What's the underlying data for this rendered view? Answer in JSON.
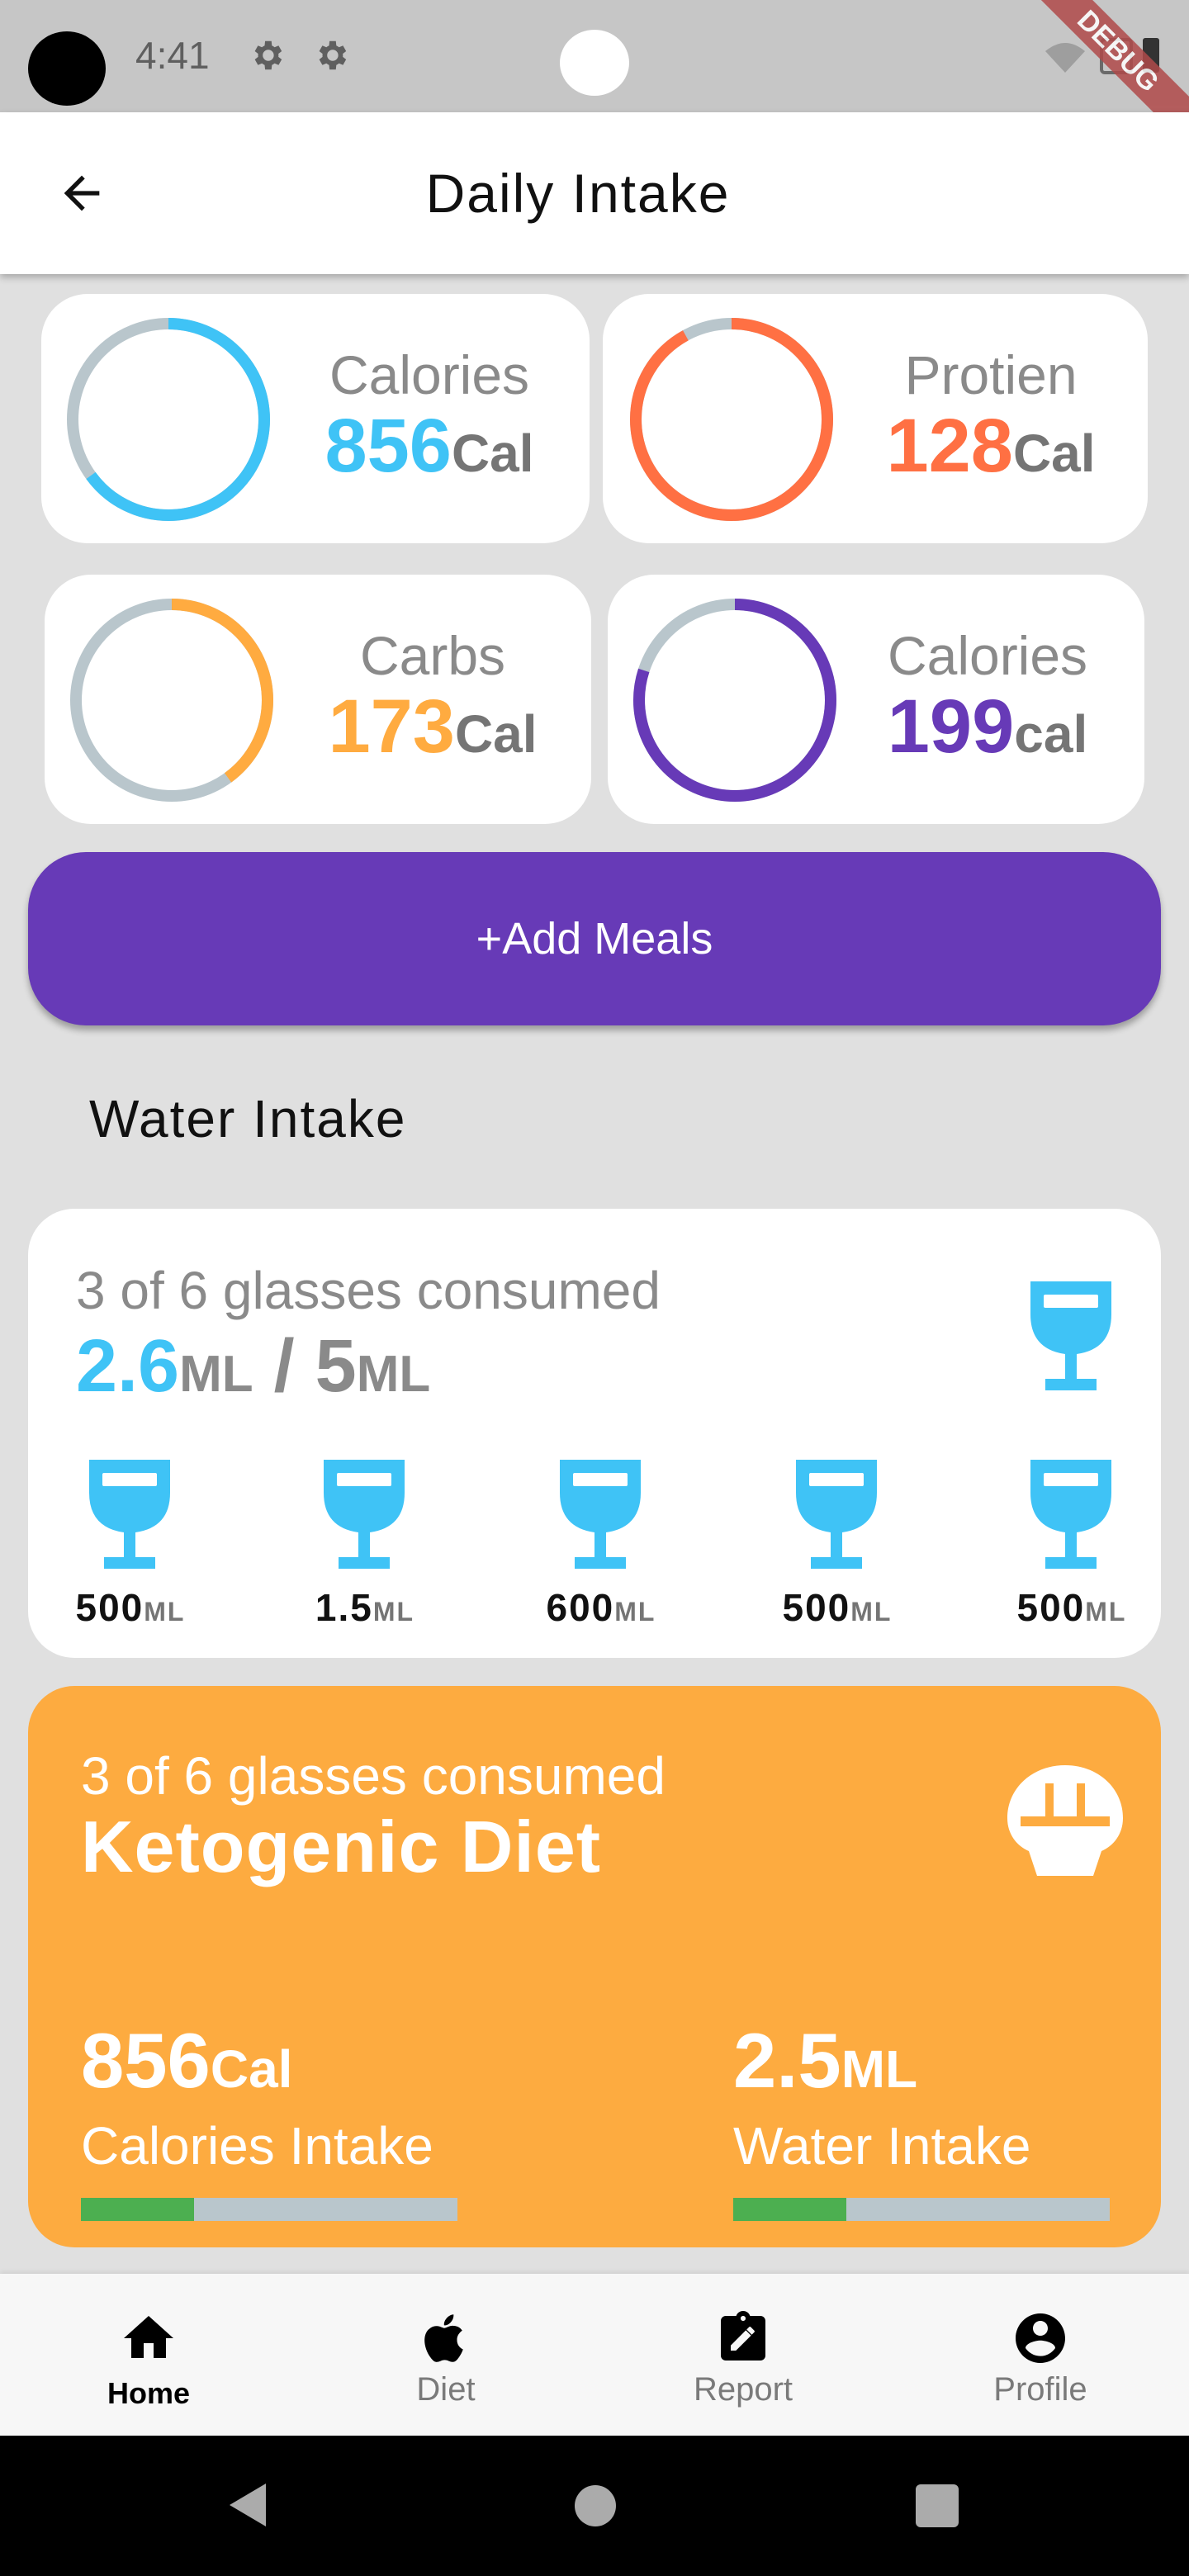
{
  "status_bar": {
    "time": "4:41",
    "debug_label": "DEBUG"
  },
  "app_bar": {
    "title": "Daily Intake"
  },
  "stats": [
    {
      "label": "Calories",
      "value": "856",
      "unit": "Cal",
      "color": "#3fc3f6",
      "progress": 0.65
    },
    {
      "label": "Protien",
      "value": "128",
      "unit": "Cal",
      "color": "#ff7043",
      "progress": 0.92
    },
    {
      "label": "Carbs",
      "value": "173",
      "unit": "Cal",
      "color": "#ffab40",
      "progress": 0.4
    },
    {
      "label": "Calories",
      "value": "199",
      "unit": "cal",
      "color": "#673ab7",
      "progress": 0.8
    }
  ],
  "add_meals_label": "+Add Meals",
  "water_section_title": "Water Intake",
  "water": {
    "consumed_text": "3 of 6 glasses consumed",
    "current": "2.6",
    "current_unit": "ML",
    "separator": " / ",
    "goal": "5",
    "goal_unit": "ML",
    "glasses": [
      {
        "amount": "500",
        "unit": "ML"
      },
      {
        "amount": "1.5",
        "unit": "ML"
      },
      {
        "amount": "600",
        "unit": "ML"
      },
      {
        "amount": "500",
        "unit": "ML"
      },
      {
        "amount": "500",
        "unit": "ML"
      }
    ]
  },
  "keto": {
    "subtitle": "3 of 6 glasses consumed",
    "title": "Ketogenic Diet",
    "calories_value": "856",
    "calories_unit": "Cal",
    "calories_label": "Calories Intake",
    "calories_progress": 0.3,
    "water_value": "2.5",
    "water_unit": "ML",
    "water_label": "Water Intake",
    "water_progress": 0.3
  },
  "bottom_nav": [
    {
      "label": "Home",
      "icon": "home-icon",
      "active": true
    },
    {
      "label": "Diet",
      "icon": "apple-icon",
      "active": false
    },
    {
      "label": "Report",
      "icon": "report-icon",
      "active": false
    },
    {
      "label": "Profile",
      "icon": "profile-icon",
      "active": false
    }
  ]
}
